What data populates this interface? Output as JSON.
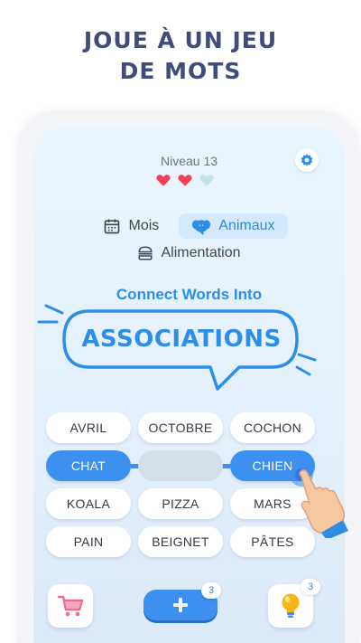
{
  "headline": {
    "line1": "JOUE À UN JEU",
    "line2": "DE MOTS"
  },
  "level": {
    "label": "Niveau 13"
  },
  "hearts": [
    {
      "icon": "heart-icon",
      "state": "full",
      "color": "#f0405a"
    },
    {
      "icon": "heart-icon",
      "state": "full",
      "color": "#f0405a"
    },
    {
      "icon": "heart-icon",
      "state": "empty",
      "color": "#bfe4ea"
    }
  ],
  "settings": {
    "icon": "gear-icon"
  },
  "categories": [
    {
      "label": "Mois",
      "icon": "calendar-icon",
      "active": false
    },
    {
      "label": "Animaux",
      "icon": "elephant-icon",
      "active": true
    },
    {
      "label": "Alimentation",
      "icon": "burger-icon",
      "active": false
    }
  ],
  "tagline": "Connect Words Into",
  "bubble": {
    "text": "ASSOCIATIONS"
  },
  "words": [
    {
      "label": "AVRIL",
      "state": "normal"
    },
    {
      "label": "OCTOBRE",
      "state": "normal"
    },
    {
      "label": "COCHON",
      "state": "normal"
    },
    {
      "label": "CHAT",
      "state": "selected"
    },
    {
      "label": "",
      "state": "empty"
    },
    {
      "label": "CHIEN",
      "state": "selected"
    },
    {
      "label": "KOALA",
      "state": "normal"
    },
    {
      "label": "PIZZA",
      "state": "normal"
    },
    {
      "label": "MARS",
      "state": "normal"
    },
    {
      "label": "PAIN",
      "state": "normal"
    },
    {
      "label": "BEIGNET",
      "state": "normal"
    },
    {
      "label": "PÂTES",
      "state": "normal"
    }
  ],
  "bottom": {
    "shop": {
      "icon": "cart-icon"
    },
    "add": {
      "icon": "plus-icon",
      "count": "3"
    },
    "hint": {
      "icon": "lightbulb-icon",
      "count": "3"
    }
  },
  "colors": {
    "accent": "#2d8ee8",
    "title": "#3f4c7c",
    "heart": "#f0405a"
  }
}
